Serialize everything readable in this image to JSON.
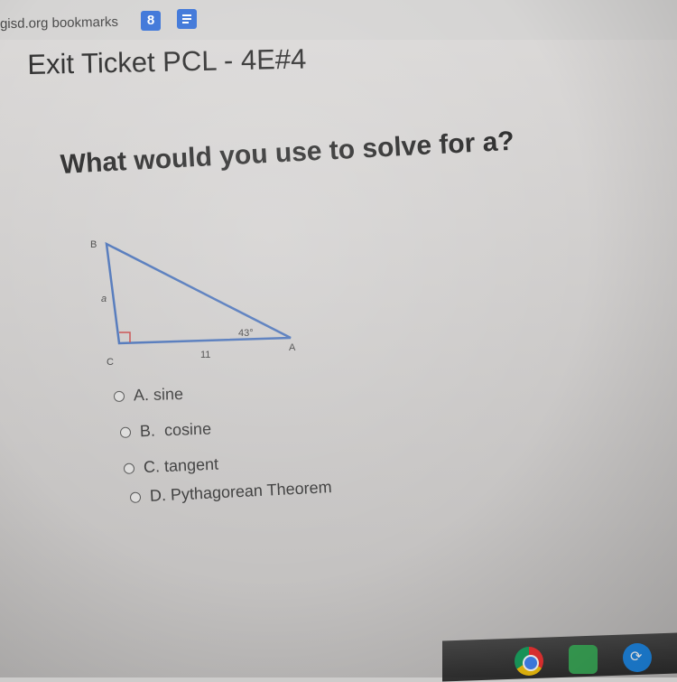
{
  "bookmarks_bar": {
    "text": "gisd.org bookmarks"
  },
  "page": {
    "title": "Exit Ticket PCL - 4E#4"
  },
  "question": {
    "text": "What would you use to solve for a?"
  },
  "diagram": {
    "vertex_b": "B",
    "vertex_c": "C",
    "vertex_a": "A",
    "side_a": "a",
    "side_ca": "11",
    "angle_a": "43°"
  },
  "options": [
    {
      "letter": "A.",
      "text": "sine"
    },
    {
      "letter": "B.",
      "text": "cosine"
    },
    {
      "letter": "C.",
      "text": "tangent"
    },
    {
      "letter": "D.",
      "text": "Pythagorean Theorem"
    }
  ],
  "taskbar": {
    "icons": [
      "chrome-icon",
      "app-icon",
      "sync-app-icon"
    ]
  }
}
